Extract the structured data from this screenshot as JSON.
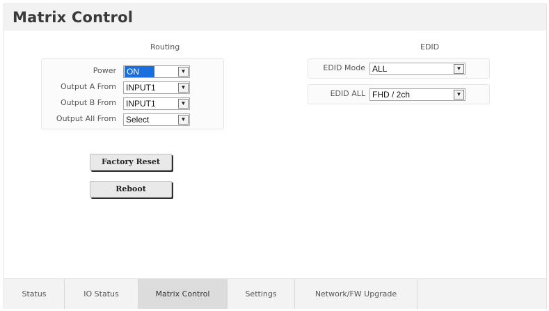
{
  "page": {
    "title": "Matrix Control"
  },
  "routing": {
    "heading": "Routing",
    "rows": [
      {
        "label": "Power",
        "value": "ON"
      },
      {
        "label": "Output A From",
        "value": "INPUT1"
      },
      {
        "label": "Output B From",
        "value": "INPUT1"
      },
      {
        "label": "Output All From",
        "value": "Select"
      }
    ]
  },
  "edid": {
    "heading": "EDID",
    "rows": [
      {
        "label": "EDID Mode",
        "value": "ALL"
      },
      {
        "label": "EDID ALL",
        "value": "FHD / 2ch"
      }
    ]
  },
  "buttons": {
    "factory_reset": "Factory Reset",
    "reboot": "Reboot"
  },
  "tabs": [
    {
      "label": "Status"
    },
    {
      "label": "IO Status"
    },
    {
      "label": "Matrix Control"
    },
    {
      "label": "Settings"
    },
    {
      "label": "Network/FW Upgrade"
    }
  ],
  "active_tab": "Matrix Control",
  "colors": {
    "selection_highlight": "#1a6fe0",
    "active_tab_bg": "#dcdcdc"
  },
  "icons": {
    "select_arrow": "chevron-down-icon"
  }
}
